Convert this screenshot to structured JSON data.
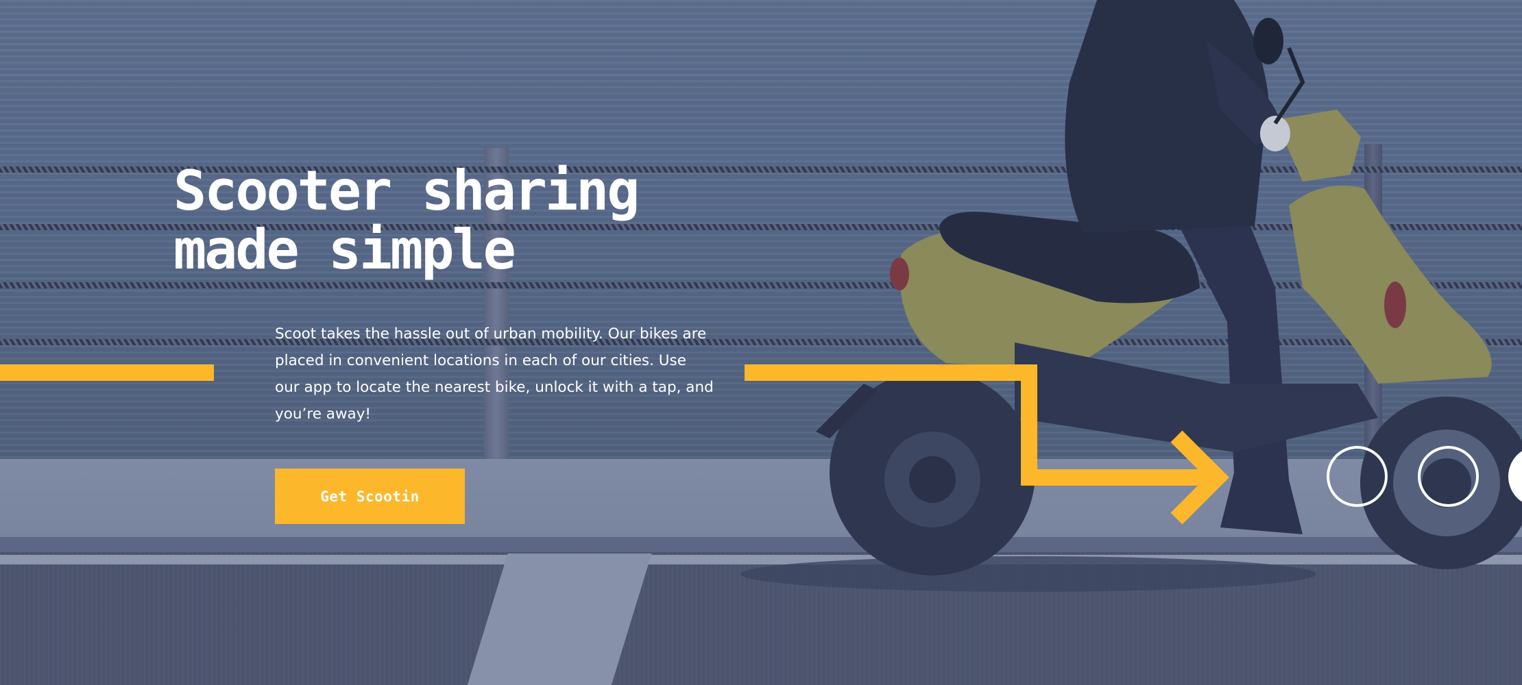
{
  "hero": {
    "title_line1": "Scooter sharing",
    "title_line2": "made simple",
    "description": "Scoot takes the hassle out of urban mobility. Our bikes are placed in convenient locations in each of our cities. Use our app to locate the nearest bike, unlock it with a tap, and you’re away!",
    "cta_label": "Get Scootin"
  },
  "colors": {
    "accent": "#fcb72b",
    "overlay": "#4a5878",
    "text": "#ffffff"
  },
  "icons": {
    "decor_arrow": "arrow-right-icon",
    "decor_circles": "circle-outline-icon"
  }
}
